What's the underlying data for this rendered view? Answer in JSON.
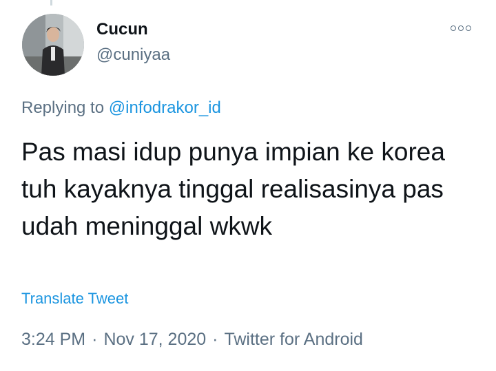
{
  "author": {
    "name": "Cucun",
    "handle": "@cuniyaa"
  },
  "reply": {
    "prefix": "Replying to",
    "mention": "@infodrakor_id"
  },
  "tweet": {
    "text": "Pas masi idup punya impian ke korea tuh kayaknya tinggal realisasinya pas udah meninggal wkwk"
  },
  "translate_label": "Translate Tweet",
  "meta": {
    "time": "3:24 PM",
    "date": "Nov 17, 2020",
    "separator": "·",
    "source": "Twitter for Android"
  },
  "icons": {
    "more": "more-options-icon"
  },
  "colors": {
    "link": "#1b95e0",
    "secondary_text": "#5b7083",
    "primary_text": "#0f1419"
  }
}
